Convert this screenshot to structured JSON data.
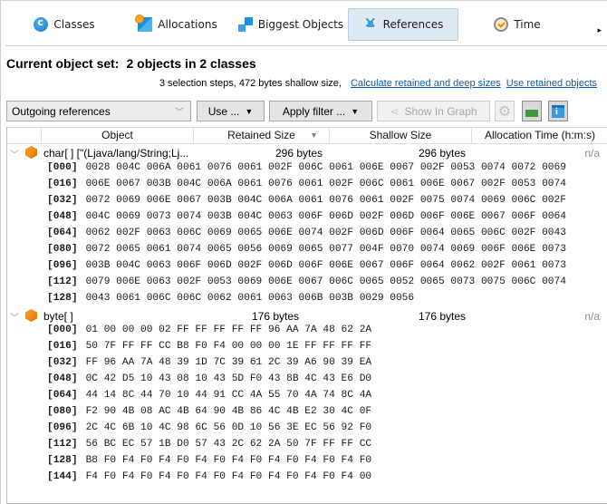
{
  "tabs": [
    {
      "label": "Classes",
      "icon": "classes-icon",
      "active": false
    },
    {
      "label": "Allocations",
      "icon": "allocations-icon",
      "active": false
    },
    {
      "label": "Biggest Objects",
      "icon": "biggest-objects-icon",
      "active": false
    },
    {
      "label": "References",
      "icon": "references-icon",
      "active": true
    },
    {
      "label": "Time",
      "icon": "clock-icon",
      "active": false
    }
  ],
  "heading": {
    "label": "Current object set:",
    "value": "2 objects in 2 classes"
  },
  "summary": {
    "text": "3 selection steps, 472 bytes shallow size,",
    "link_calculate": "Calculate retained and deep sizes",
    "link_use_retained": "Use retained objects"
  },
  "toolbar": {
    "view_select": "Outgoing references",
    "use_button": "Use ...",
    "apply_filter_button": "Apply filter ...",
    "show_in_graph_button": "Show In Graph",
    "settings_icon": "gear-icon",
    "export_icon": "screenshot-icon",
    "info_icon": "info-icon"
  },
  "table": {
    "columns": [
      "Object",
      "Retained Size",
      "Shallow Size",
      "Allocation Time (h:m:s)"
    ],
    "rows": [
      {
        "name": "char[ ] [\"(Ljava/lang/String;Lj...",
        "retained": "296 bytes",
        "shallow": "296 bytes",
        "alloc_time": "n/a",
        "data": [
          {
            "index": "[000]",
            "values": "0028 004C 006A 0061 0076 0061 002F 006C 0061 006E 0067 002F 0053 0074 0072 0069"
          },
          {
            "index": "[016]",
            "values": "006E 0067 003B 004C 006A 0061 0076 0061 002F 006C 0061 006E 0067 002F 0053 0074"
          },
          {
            "index": "[032]",
            "values": "0072 0069 006E 0067 003B 004C 006A 0061 0076 0061 002F 0075 0074 0069 006C 002F"
          },
          {
            "index": "[048]",
            "values": "004C 0069 0073 0074 003B 004C 0063 006F 006D 002F 006D 006F 006E 0067 006F 0064"
          },
          {
            "index": "[064]",
            "values": "0062 002F 0063 006C 0069 0065 006E 0074 002F 006D 006F 0064 0065 006C 002F 0043"
          },
          {
            "index": "[080]",
            "values": "0072 0065 0061 0074 0065 0056 0069 0065 0077 004F 0070 0074 0069 006F 006E 0073"
          },
          {
            "index": "[096]",
            "values": "003B 004C 0063 006F 006D 002F 006D 006F 006E 0067 006F 0064 0062 002F 0061 0073"
          },
          {
            "index": "[112]",
            "values": "0079 006E 0063 002F 0053 0069 006E 0067 006C 0065 0052 0065 0073 0075 006C 0074"
          },
          {
            "index": "[128]",
            "values": "0043 0061 006C 006C 0062 0061 0063 006B 003B 0029 0056"
          }
        ]
      },
      {
        "name": "byte[ ]",
        "retained": "176 bytes",
        "shallow": "176 bytes",
        "alloc_time": "n/a",
        "data": [
          {
            "index": "[000]",
            "values": "01 00 00 00 02 FF FF FF FF FF 96 AA 7A 48 62 2A"
          },
          {
            "index": "[016]",
            "values": "50 7F FF FF CC B8 F0 F4 00 00 00 1E FF FF FF FF"
          },
          {
            "index": "[032]",
            "values": "FF 96 AA 7A 48 39 1D 7C 39 61 2C 39 A6 90 39 EA"
          },
          {
            "index": "[048]",
            "values": "0C 42 D5 10 43 08 10 43 5D F0 43 8B 4C 43 E6 D0"
          },
          {
            "index": "[064]",
            "values": "44 14 8C 44 70 10 44 91 CC 4A 55 70 4A 74 8C 4A"
          },
          {
            "index": "[080]",
            "values": "F2 90 4B 08 AC 4B 64 90 4B 86 4C 4B E2 30 4C 0F"
          },
          {
            "index": "[096]",
            "values": "2C 4C 6B 10 4C 98 6C 56 0D 10 56 3E EC 56 92 F0"
          },
          {
            "index": "[112]",
            "values": "56 BC EC 57 1B D0 57 43 2C 62 2A 50 7F FF FF CC"
          },
          {
            "index": "[128]",
            "values": "B8 F0 F4 F0 F4 F0 F4 F0 F4 F0 F4 F0 F4 F0 F4 F0"
          },
          {
            "index": "[144]",
            "values": "F4 F0 F4 F0 F4 F0 F4 F0 F4 F0 F4 F0 F4 F0 F4 00"
          }
        ]
      }
    ]
  }
}
